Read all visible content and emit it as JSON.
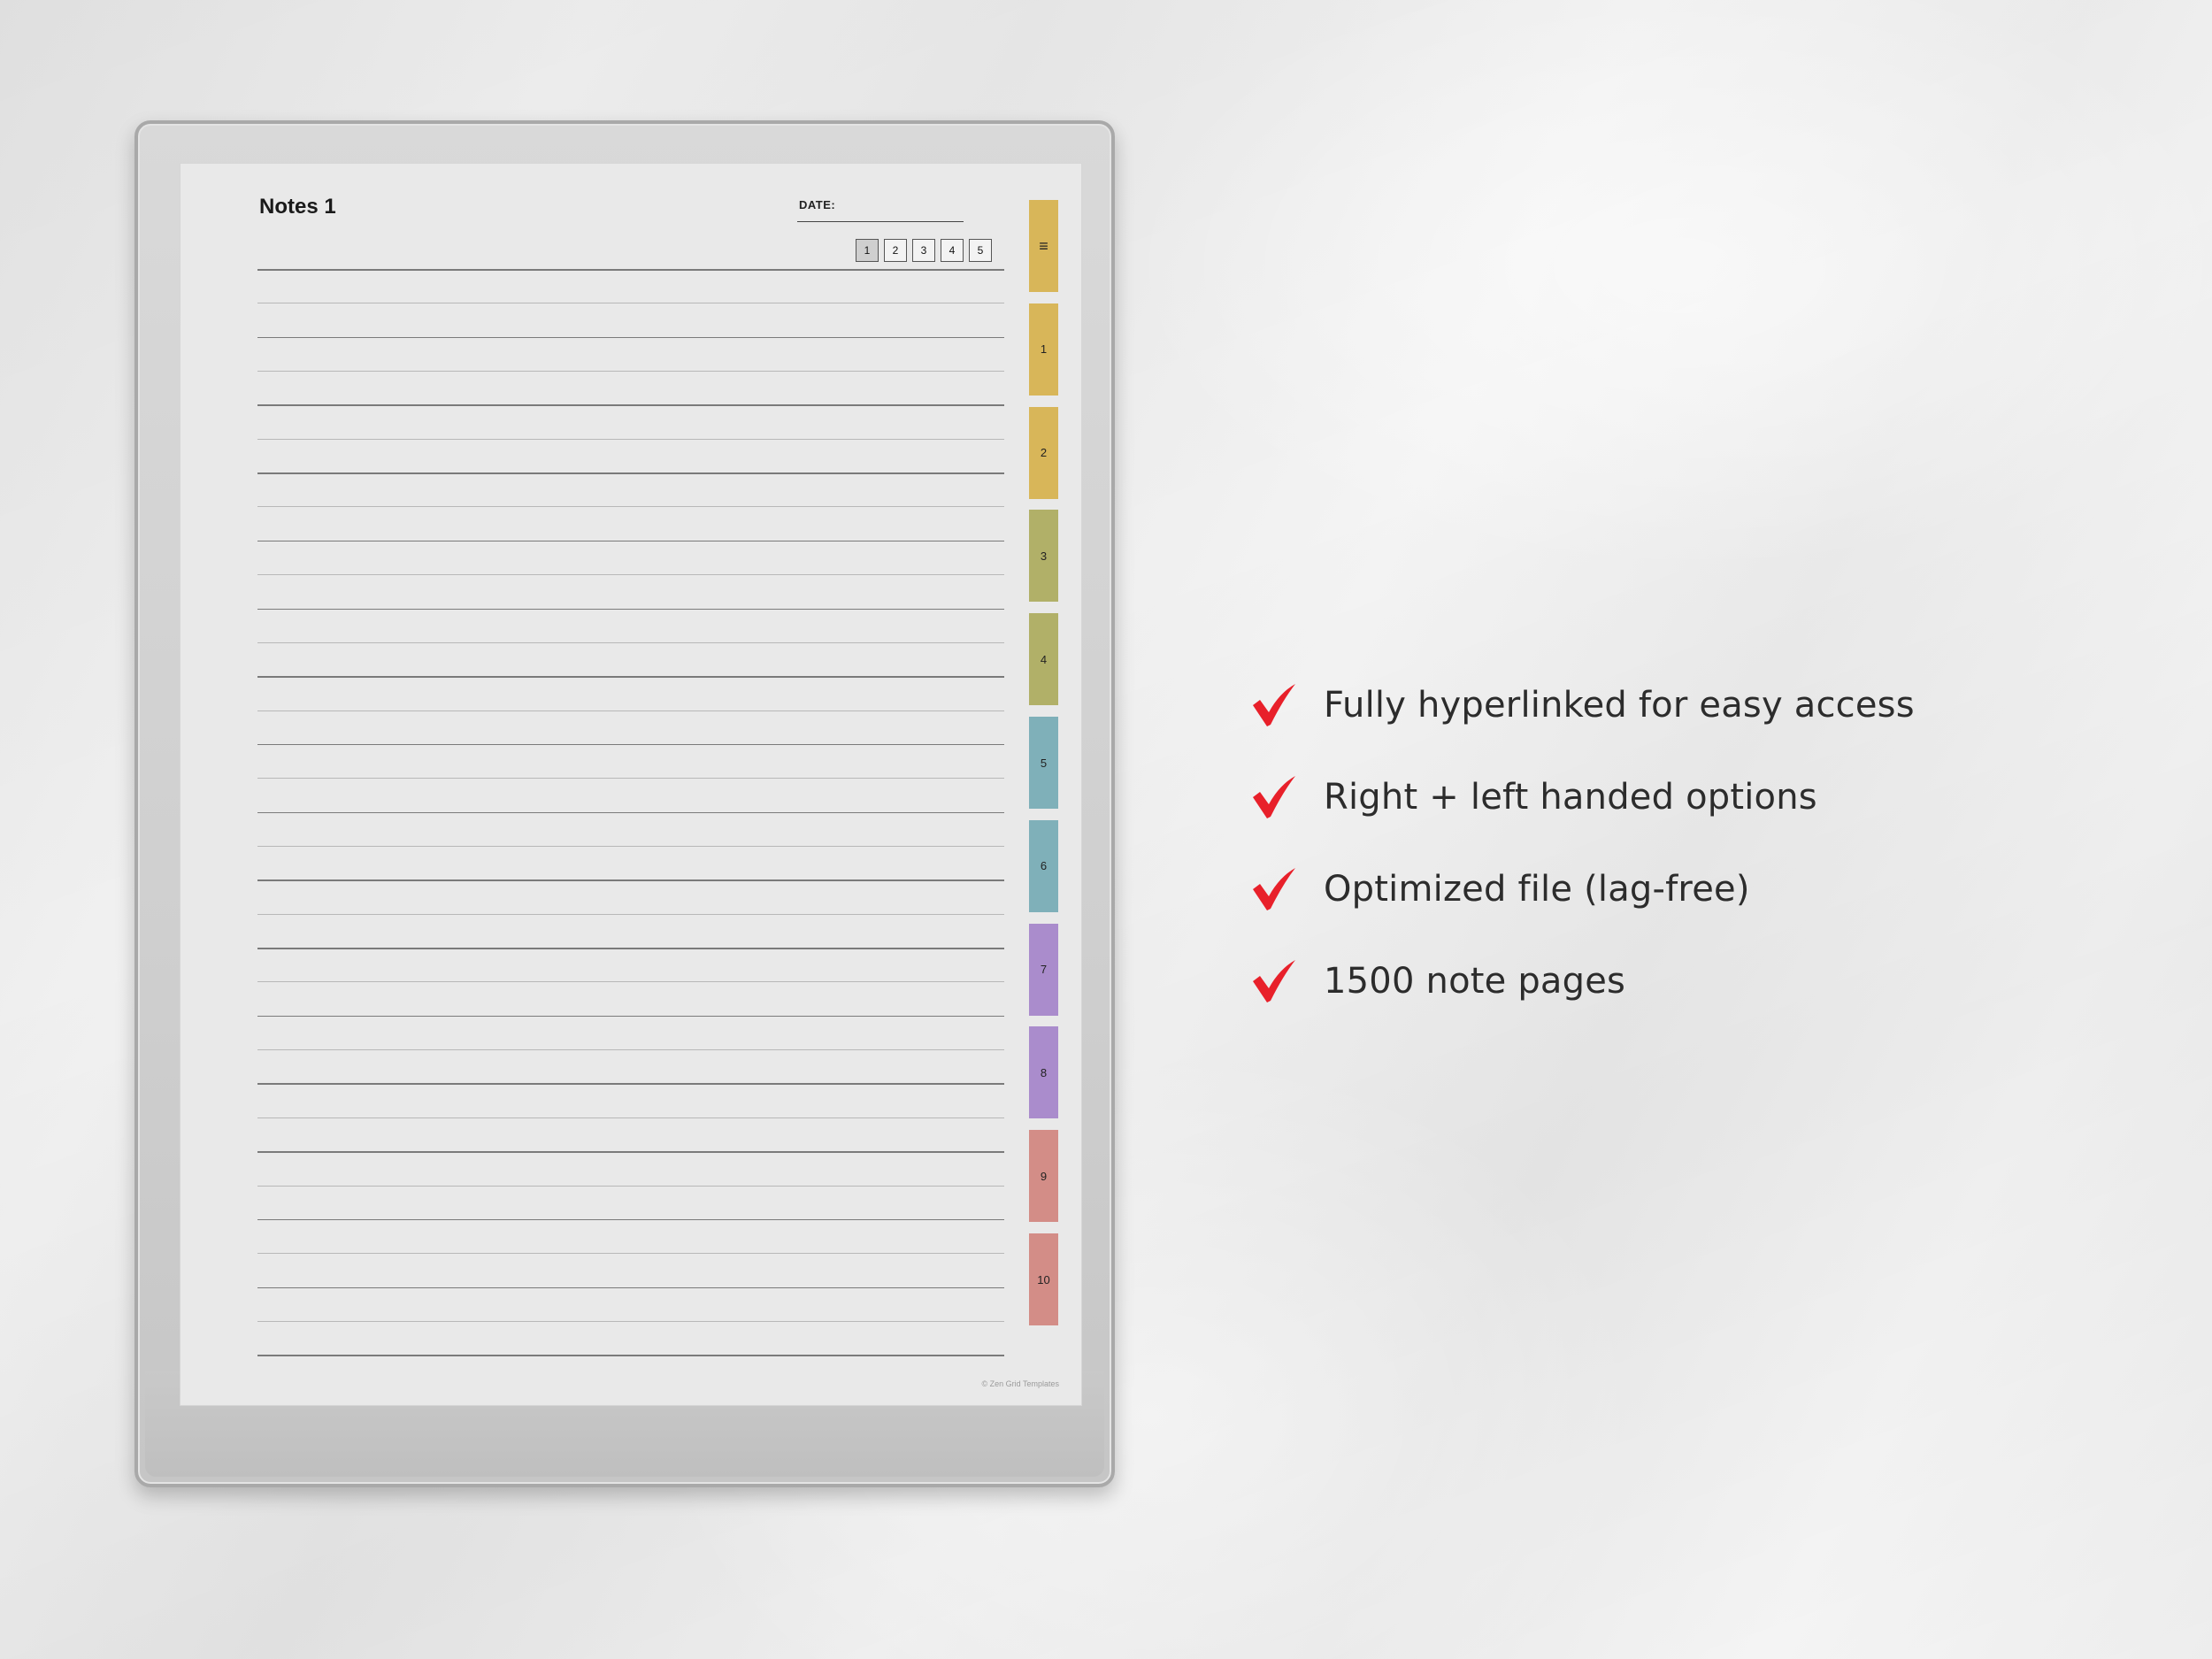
{
  "notebook": {
    "title": "Notes 1",
    "date_label": "DATE:",
    "page_buttons": [
      "1",
      "2",
      "3",
      "4",
      "5"
    ],
    "active_page": "1",
    "footer": "© Zen Grid Templates",
    "tabs": [
      {
        "label": "≡",
        "color": "#d8b659",
        "icon": "menu-icon"
      },
      {
        "label": "1",
        "color": "#d8b659"
      },
      {
        "label": "2",
        "color": "#d8b659"
      },
      {
        "label": "3",
        "color": "#b1b068"
      },
      {
        "label": "4",
        "color": "#b1b068"
      },
      {
        "label": "5",
        "color": "#7fb0b9"
      },
      {
        "label": "6",
        "color": "#7fb0b9"
      },
      {
        "label": "7",
        "color": "#aa8ccc"
      },
      {
        "label": "8",
        "color": "#aa8ccc"
      },
      {
        "label": "9",
        "color": "#d38d87"
      },
      {
        "label": "10",
        "color": "#d38d87"
      }
    ]
  },
  "features": [
    {
      "text": "Fully hyperlinked for easy access",
      "icon": "checkmark-icon"
    },
    {
      "text": "Right + left handed options",
      "icon": "checkmark-icon"
    },
    {
      "text": "Optimized file (lag-free)",
      "icon": "checkmark-icon"
    },
    {
      "text": "1500 note pages",
      "icon": "checkmark-icon"
    }
  ],
  "colors": {
    "check": "#e8202a",
    "page": "#e9e9e9",
    "frame": "#a9a9a9"
  }
}
